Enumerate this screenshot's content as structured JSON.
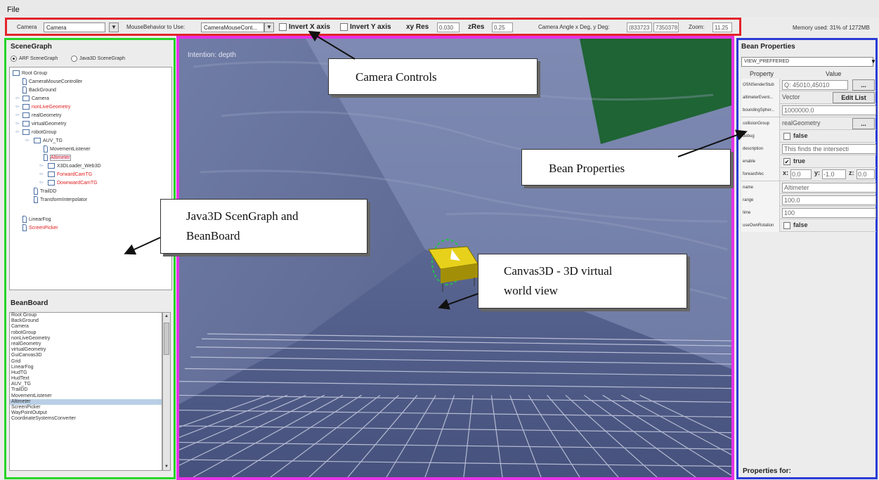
{
  "menubar": {
    "file_label": "File"
  },
  "toolbar": {
    "camera_label": "Camera",
    "camera_value": "Camera",
    "mouse_label": "MouseBehavior to Use:",
    "mouse_value": "CameraMouseCont...",
    "invert_x_label": "Invert X axis",
    "invert_y_label": "Invert Y axis",
    "xy_res_label": "xy Res",
    "xy_res_value": "0.030",
    "z_res_label": "zRes",
    "z_res_value": "0.25",
    "camera_angle_label": "Camera Angle x Deg, y Deg:",
    "angle_x_value": "(833723",
    "angle_y_value": "7350378",
    "zoom_label": "Zoom:",
    "zoom_value": "11.25",
    "memory_used": "Memory used: 31% of 1272MB"
  },
  "scenegraph": {
    "title": "SceneGraph",
    "radio_arf": "ARF SceneGraph",
    "radio_java3d": "Java3D SceneGraph",
    "nodes": [
      {
        "label": "Root Group",
        "color": "#333333"
      },
      {
        "label": "CameraMouseController",
        "color": "#333333"
      },
      {
        "label": "BackGround",
        "color": "#333333"
      },
      {
        "label": "Camera",
        "color": "#333333"
      },
      {
        "label": "nonLiveGeometry",
        "color": "#e02020"
      },
      {
        "label": "realGeometry",
        "color": "#333333"
      },
      {
        "label": "virtualGeometry",
        "color": "#333333"
      },
      {
        "label": "robotGroup",
        "color": "#333333"
      },
      {
        "label": "AUV_TG",
        "color": "#333333"
      },
      {
        "label": "MovementListener",
        "color": "#333333"
      },
      {
        "label": "Altimeter",
        "color": "#e02020"
      },
      {
        "label": "X3DLoader_Web3D",
        "color": "#333333"
      },
      {
        "label": "ForwardCamTG",
        "color": "#e02020"
      },
      {
        "label": "DownwardCamTG",
        "color": "#e02020"
      },
      {
        "label": "TrailDD",
        "color": "#333333"
      },
      {
        "label": "TransformInterpolator",
        "color": "#333333"
      },
      {
        "label": "LinearFog",
        "color": "#333333"
      },
      {
        "label": "ScreenPicker",
        "color": "#e02020"
      }
    ]
  },
  "beanboard": {
    "title": "BeanBoard",
    "items": [
      "Root Group",
      "BackGround",
      "Camera",
      "robotGroup",
      "nonLiveGeometry",
      "realGeometry",
      "virtualGeometry",
      "GuiCanvas3D",
      "Grid",
      "LinearFog",
      "HudTG",
      "HudText",
      "AUV_TG",
      "TrailDD",
      "MovementListener",
      "Altimeter",
      "ScreenPicker",
      "WayPointOutput",
      "CoordinateSystemsConverter"
    ],
    "selected_index": 15
  },
  "canvas": {
    "intention_label": "Intention: depth"
  },
  "bean_properties": {
    "title": "Bean Properties",
    "view_mode": "VIEW_PREFFERED",
    "col_property": "Property",
    "col_value": "Value",
    "rows": [
      {
        "name": "OSNSenderStub",
        "value": "Q: 45010,45010",
        "kind": "input-btn",
        "btn": "..."
      },
      {
        "name": "altimeterEvent...",
        "value": "Vector",
        "kind": "text-btn",
        "btn": "Edit List"
      },
      {
        "name": "boundingSpher...",
        "value": "1000000.0",
        "kind": "input"
      },
      {
        "name": "collisionGroup",
        "value": "realGeometry",
        "kind": "text-btn",
        "btn": "..."
      },
      {
        "name": "debug",
        "value": "false",
        "kind": "check",
        "checked": false
      },
      {
        "name": "description",
        "value": "This finds the intersecti",
        "kind": "input"
      },
      {
        "name": "enable",
        "value": "true",
        "kind": "check",
        "checked": true
      },
      {
        "name": "forwardVec",
        "kind": "vector",
        "x_label": "x:",
        "x": "0.0",
        "y_label": "y:",
        "y": "-1.0",
        "z_label": "z:",
        "z": "0.0"
      },
      {
        "name": "name",
        "value": "Altimeter",
        "kind": "input"
      },
      {
        "name": "range",
        "value": "100.0",
        "kind": "input"
      },
      {
        "name": "time",
        "value": "100",
        "kind": "input"
      },
      {
        "name": "useOwnRotation",
        "value": "false",
        "kind": "check",
        "checked": false
      }
    ],
    "properties_for": "Properties for:"
  },
  "callouts": {
    "camera_controls": "Camera Controls",
    "bean_properties": "Bean Properties",
    "scengraph_line1": "Java3D ScenGraph and",
    "scengraph_line2": "BeanBoard",
    "canvas_line1": "Canvas3D  - 3D virtual",
    "canvas_line2": "world view"
  },
  "colors": {
    "toolbar_border": "#e3242b",
    "left_border": "#27d427",
    "center_border": "#e631e6",
    "right_border": "#2a3bd6",
    "highlight_red": "#e02020"
  }
}
